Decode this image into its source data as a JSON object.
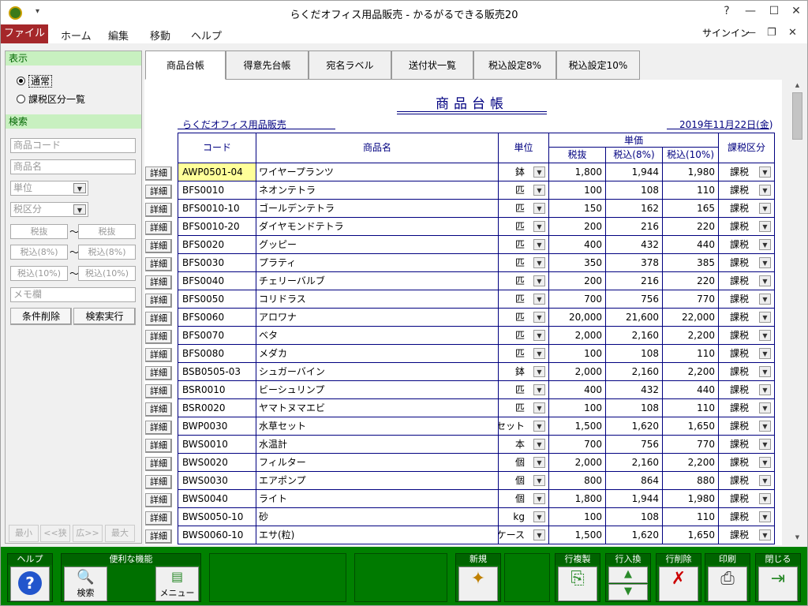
{
  "window": {
    "title": "らくだオフィス用品販売 - かるがるできる販売20",
    "help": "?",
    "qat": "▾"
  },
  "menu": {
    "file": "ファイル",
    "home": "ホーム",
    "edit": "編集",
    "move": "移動",
    "help": "ヘルプ",
    "signin": "サインイン"
  },
  "left": {
    "display_header": "表示",
    "radio_normal": "通常",
    "radio_tax": "課税区分一覧",
    "search_header": "検索",
    "code_ph": "商品コード",
    "name_ph": "商品名",
    "unit_ph": "単位",
    "taxcls_ph": "税区分",
    "tax_ex": "税抜",
    "tax8": "税込(8%)",
    "tax10": "税込(10%)",
    "tilde": "〜",
    "memo_ph": "メモ欄",
    "clear": "条件削除",
    "run": "検索実行",
    "zoom_min": "最小",
    "zoom_narrow": "<<狭",
    "zoom_wide": "広>>",
    "zoom_max": "最大"
  },
  "tabs": [
    "商品台帳",
    "得意先台帳",
    "宛名ラベル",
    "送付状一覧",
    "税込設定8%",
    "税込設定10%"
  ],
  "doc": {
    "title": "商品台帳",
    "company": "らくだオフィス用品販売",
    "date": "2019年11月22日(金)",
    "h_code": "コード",
    "h_name": "商品名",
    "h_unit": "単位",
    "h_price": "単価",
    "h_ex": "税抜",
    "h_8": "税込(8%)",
    "h_10": "税込(10%)",
    "h_tax": "課税区分",
    "detail": "詳細"
  },
  "rows": [
    {
      "code": "AWP0501-04",
      "name": "ワイヤープランツ",
      "unit": "鉢",
      "ex": "1,800",
      "t8": "1,944",
      "t10": "1,980",
      "tax": "課税"
    },
    {
      "code": "BFS0010",
      "name": "ネオンテトラ",
      "unit": "匹",
      "ex": "100",
      "t8": "108",
      "t10": "110",
      "tax": "課税"
    },
    {
      "code": "BFS0010-10",
      "name": "ゴールデンテトラ",
      "unit": "匹",
      "ex": "150",
      "t8": "162",
      "t10": "165",
      "tax": "課税"
    },
    {
      "code": "BFS0010-20",
      "name": "ダイヤモンドテトラ",
      "unit": "匹",
      "ex": "200",
      "t8": "216",
      "t10": "220",
      "tax": "課税"
    },
    {
      "code": "BFS0020",
      "name": "グッピー",
      "unit": "匹",
      "ex": "400",
      "t8": "432",
      "t10": "440",
      "tax": "課税"
    },
    {
      "code": "BFS0030",
      "name": "プラティ",
      "unit": "匹",
      "ex": "350",
      "t8": "378",
      "t10": "385",
      "tax": "課税"
    },
    {
      "code": "BFS0040",
      "name": "チェリーバルブ",
      "unit": "匹",
      "ex": "200",
      "t8": "216",
      "t10": "220",
      "tax": "課税"
    },
    {
      "code": "BFS0050",
      "name": "コリドラス",
      "unit": "匹",
      "ex": "700",
      "t8": "756",
      "t10": "770",
      "tax": "課税"
    },
    {
      "code": "BFS0060",
      "name": "アロワナ",
      "unit": "匹",
      "ex": "20,000",
      "t8": "21,600",
      "t10": "22,000",
      "tax": "課税"
    },
    {
      "code": "BFS0070",
      "name": "ベタ",
      "unit": "匹",
      "ex": "2,000",
      "t8": "2,160",
      "t10": "2,200",
      "tax": "課税"
    },
    {
      "code": "BFS0080",
      "name": "メダカ",
      "unit": "匹",
      "ex": "100",
      "t8": "108",
      "t10": "110",
      "tax": "課税"
    },
    {
      "code": "BSB0505-03",
      "name": "シュガーバイン",
      "unit": "鉢",
      "ex": "2,000",
      "t8": "2,160",
      "t10": "2,200",
      "tax": "課税"
    },
    {
      "code": "BSR0010",
      "name": "ビーシュリンプ",
      "unit": "匹",
      "ex": "400",
      "t8": "432",
      "t10": "440",
      "tax": "課税"
    },
    {
      "code": "BSR0020",
      "name": "ヤマトヌマエビ",
      "unit": "匹",
      "ex": "100",
      "t8": "108",
      "t10": "110",
      "tax": "課税"
    },
    {
      "code": "BWP0030",
      "name": "水草セット",
      "unit": "セット",
      "ex": "1,500",
      "t8": "1,620",
      "t10": "1,650",
      "tax": "課税"
    },
    {
      "code": "BWS0010",
      "name": "水温計",
      "unit": "本",
      "ex": "700",
      "t8": "756",
      "t10": "770",
      "tax": "課税"
    },
    {
      "code": "BWS0020",
      "name": "フィルター",
      "unit": "個",
      "ex": "2,000",
      "t8": "2,160",
      "t10": "2,200",
      "tax": "課税"
    },
    {
      "code": "BWS0030",
      "name": "エアポンプ",
      "unit": "個",
      "ex": "800",
      "t8": "864",
      "t10": "880",
      "tax": "課税"
    },
    {
      "code": "BWS0040",
      "name": "ライト",
      "unit": "個",
      "ex": "1,800",
      "t8": "1,944",
      "t10": "1,980",
      "tax": "課税"
    },
    {
      "code": "BWS0050-10",
      "name": "砂",
      "unit": "kg",
      "ex": "100",
      "t8": "108",
      "t10": "110",
      "tax": "課税"
    },
    {
      "code": "BWS0060-10",
      "name": "エサ(粒)",
      "unit": "ケース",
      "ex": "1,500",
      "t8": "1,620",
      "t10": "1,650",
      "tax": "課税"
    }
  ],
  "footer": {
    "help": "ヘルプ",
    "tools": "便利な機能",
    "search": "検索",
    "menu": "メニュー",
    "new": "新規",
    "copy": "行複製",
    "swap": "行入換",
    "del": "行削除",
    "print": "印刷",
    "close": "閉じる"
  }
}
